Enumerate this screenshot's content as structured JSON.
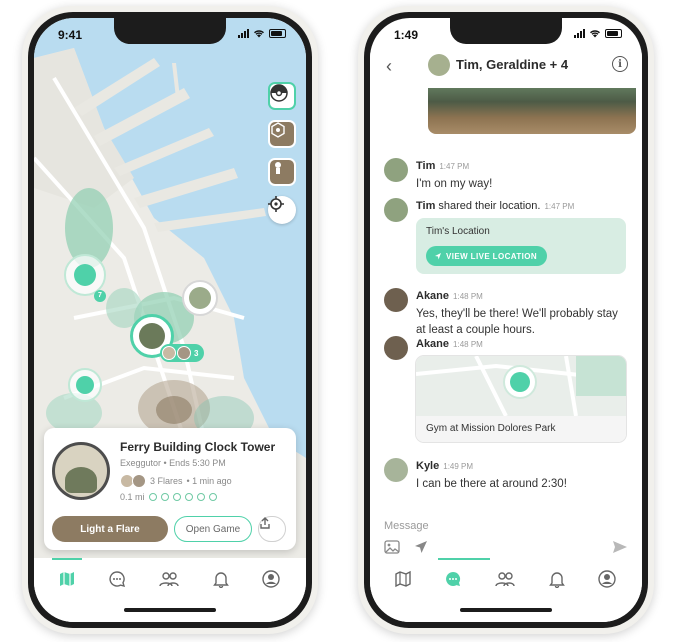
{
  "left_phone": {
    "status_time": "9:41",
    "map": {
      "gym_card": {
        "title": "Ferry Building Clock Tower",
        "subtitle": "Exeggutor • Ends 5:30 PM",
        "flares": "3 Flares",
        "flares_time": "• 1 min ago",
        "distance": "0.1 mi",
        "light_flare_label": "Light a Flare",
        "open_game_label": "Open Game"
      },
      "pin_badge_count_1": "7",
      "pin_badge_count_2": "3"
    },
    "tabs": [
      "map-icon",
      "chat-icon",
      "friends-icon",
      "bell-icon",
      "profile-icon"
    ],
    "accent": "#4fd1a9",
    "brand_brown": "#8d7b62"
  },
  "right_phone": {
    "status_time": "1:49",
    "header_title": "Tim, Geraldine + 4",
    "messages": [
      {
        "name": "Tim",
        "time": "1:47 PM",
        "text": "I'm on my way!"
      },
      {
        "name": "Tim",
        "text": "shared their location.",
        "time": "1:47 PM",
        "card_title": "Tim's Location",
        "card_button": "VIEW LIVE LOCATION"
      },
      {
        "name": "Akane",
        "time": "1:48 PM",
        "text": "Yes, they'll be there! We'll probably stay at least a couple hours."
      },
      {
        "name": "Akane",
        "time": "1:48 PM",
        "gym_caption": "Gym at Mission Dolores Park"
      },
      {
        "name": "Kyle",
        "time": "1:49 PM",
        "text": "I can be there at around 2:30!"
      }
    ],
    "input_placeholder": "Message"
  }
}
